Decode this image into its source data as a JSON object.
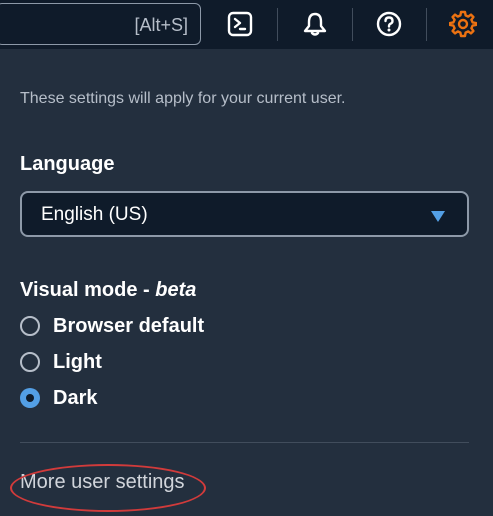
{
  "topbar": {
    "search_shortcut": "[Alt+S]",
    "icons": [
      "cloudshell-icon",
      "bell-icon",
      "help-icon",
      "gear-icon"
    ],
    "accent_color": "#ec7211"
  },
  "settings": {
    "description": "These settings will apply for your current user.",
    "language": {
      "label": "Language",
      "selected": "English (US)"
    },
    "visual_mode": {
      "label_main": "Visual mode - ",
      "label_beta": "beta",
      "options": [
        {
          "label": "Browser default",
          "checked": false
        },
        {
          "label": "Light",
          "checked": false
        },
        {
          "label": "Dark",
          "checked": true
        }
      ]
    },
    "more_link": "More user settings"
  },
  "colors": {
    "panel_bg": "#232f3e",
    "topbar_bg": "#0f1b2a",
    "radio_selected": "#539fe5",
    "annotation": "#d13b3b"
  }
}
